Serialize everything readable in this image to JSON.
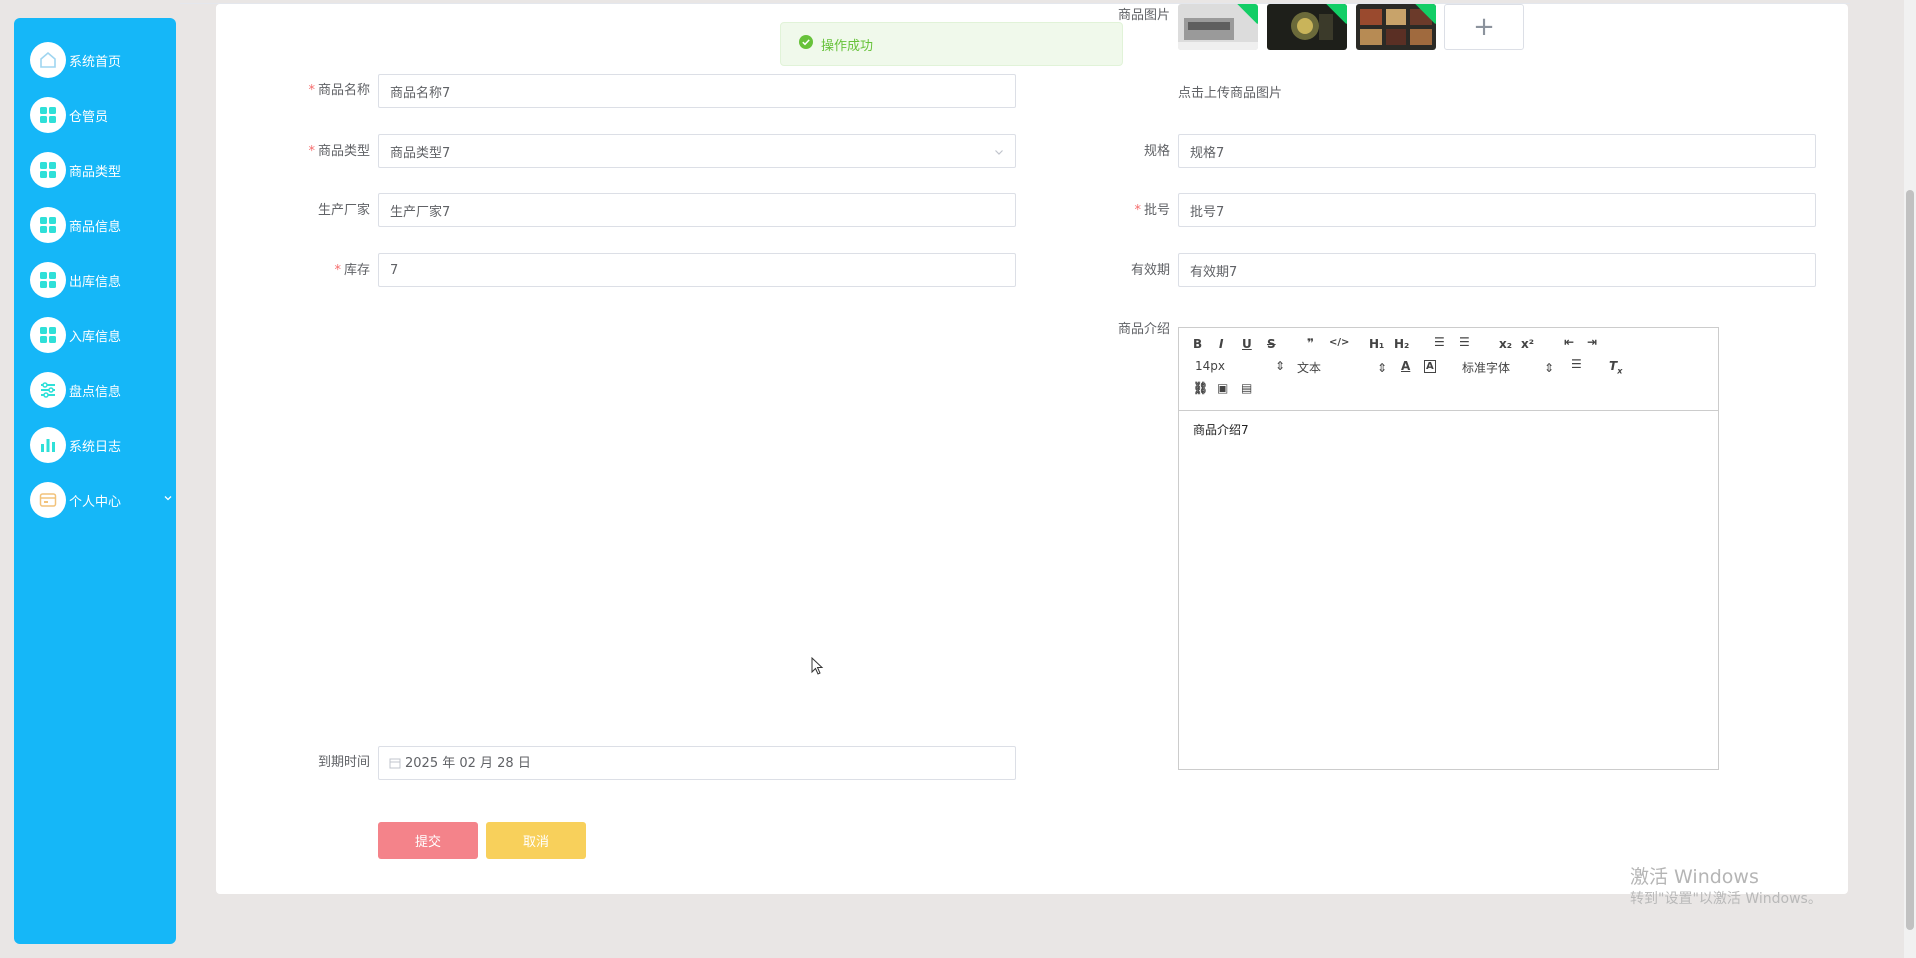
{
  "sidebar": {
    "items": [
      {
        "label": "系统首页",
        "icon": "home-icon"
      },
      {
        "label": "仓管员",
        "icon": "grid-icon"
      },
      {
        "label": "商品类型",
        "icon": "grid-icon"
      },
      {
        "label": "商品信息",
        "icon": "grid-icon"
      },
      {
        "label": "出库信息",
        "icon": "grid-icon"
      },
      {
        "label": "入库信息",
        "icon": "grid-icon"
      },
      {
        "label": "盘点信息",
        "icon": "sliders-icon"
      },
      {
        "label": "系统日志",
        "icon": "bar-chart-icon"
      },
      {
        "label": "个人中心",
        "icon": "wallet-icon"
      }
    ]
  },
  "toast": {
    "text": "操作成功"
  },
  "form": {
    "name": {
      "label": "商品名称",
      "value": "商品名称7"
    },
    "type": {
      "label": "商品类型",
      "value": "商品类型7"
    },
    "maker": {
      "label": "生产厂家",
      "value": "生产厂家7"
    },
    "stock": {
      "label": "库存",
      "value": "7"
    },
    "expire": {
      "label": "到期时间",
      "value": "2025 年 02 月 28 日"
    },
    "image": {
      "label": "商品图片",
      "hint": "点击上传商品图片",
      "add": "+"
    },
    "spec": {
      "label": "规格",
      "value": "规格7"
    },
    "batch": {
      "label": "批号",
      "value": "批号7"
    },
    "valid": {
      "label": "有效期",
      "value": "有效期7"
    },
    "intro": {
      "label": "商品介绍",
      "content": "商品介绍7"
    }
  },
  "editor": {
    "font_size": "14px",
    "header": "文本",
    "font": "标准字体",
    "h1": "H₁",
    "h2": "H₂"
  },
  "buttons": {
    "submit": "提交",
    "cancel": "取消"
  },
  "watermark": {
    "line1": "激活 Windows",
    "line2": "转到\"设置\"以激活 Windows。"
  }
}
